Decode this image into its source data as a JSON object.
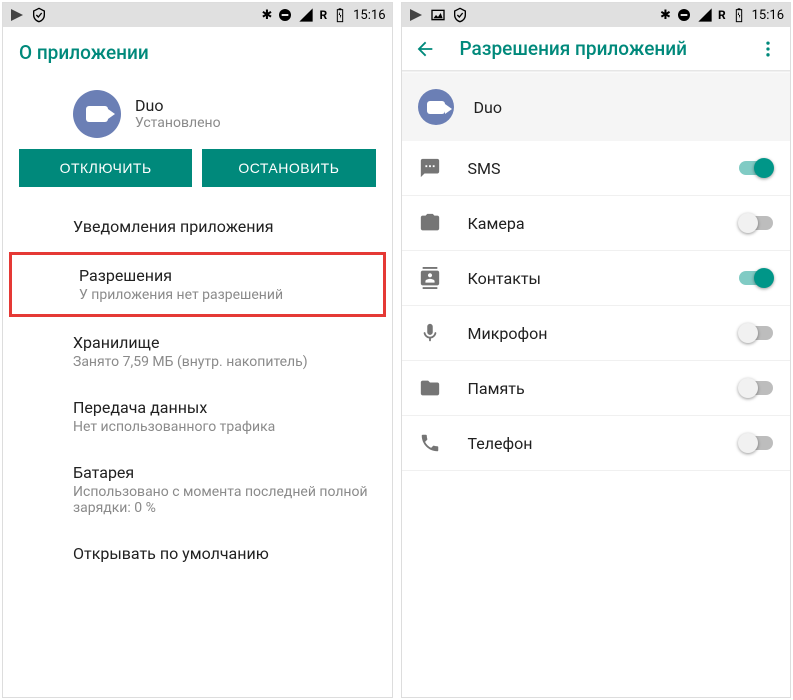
{
  "status": {
    "time": "15:16",
    "network_label": "R"
  },
  "left_screen": {
    "header_title": "О приложении",
    "app_name": "Duo",
    "app_status": "Установлено",
    "btn_disable": "ОТКЛЮЧИТЬ",
    "btn_stop": "ОСТАНОВИТЬ",
    "items": [
      {
        "title": "Уведомления приложения",
        "sub": ""
      },
      {
        "title": "Разрешения",
        "sub": "У приложения нет разрешений"
      },
      {
        "title": "Хранилище",
        "sub": "Занято 7,59 МБ (внутр. накопитель)"
      },
      {
        "title": "Передача данных",
        "sub": "Нет использованного трафика"
      },
      {
        "title": "Батарея",
        "sub": "Использовано с момента последней полной зарядки: 0 %"
      },
      {
        "title": "Открывать по умолчанию",
        "sub": ""
      }
    ]
  },
  "right_screen": {
    "header_title": "Разрешения приложений",
    "app_name": "Duo",
    "permissions": [
      {
        "label": "SMS",
        "on": true
      },
      {
        "label": "Камера",
        "on": false
      },
      {
        "label": "Контакты",
        "on": true
      },
      {
        "label": "Микрофон",
        "on": false
      },
      {
        "label": "Память",
        "on": false
      },
      {
        "label": "Телефон",
        "on": false
      }
    ]
  }
}
